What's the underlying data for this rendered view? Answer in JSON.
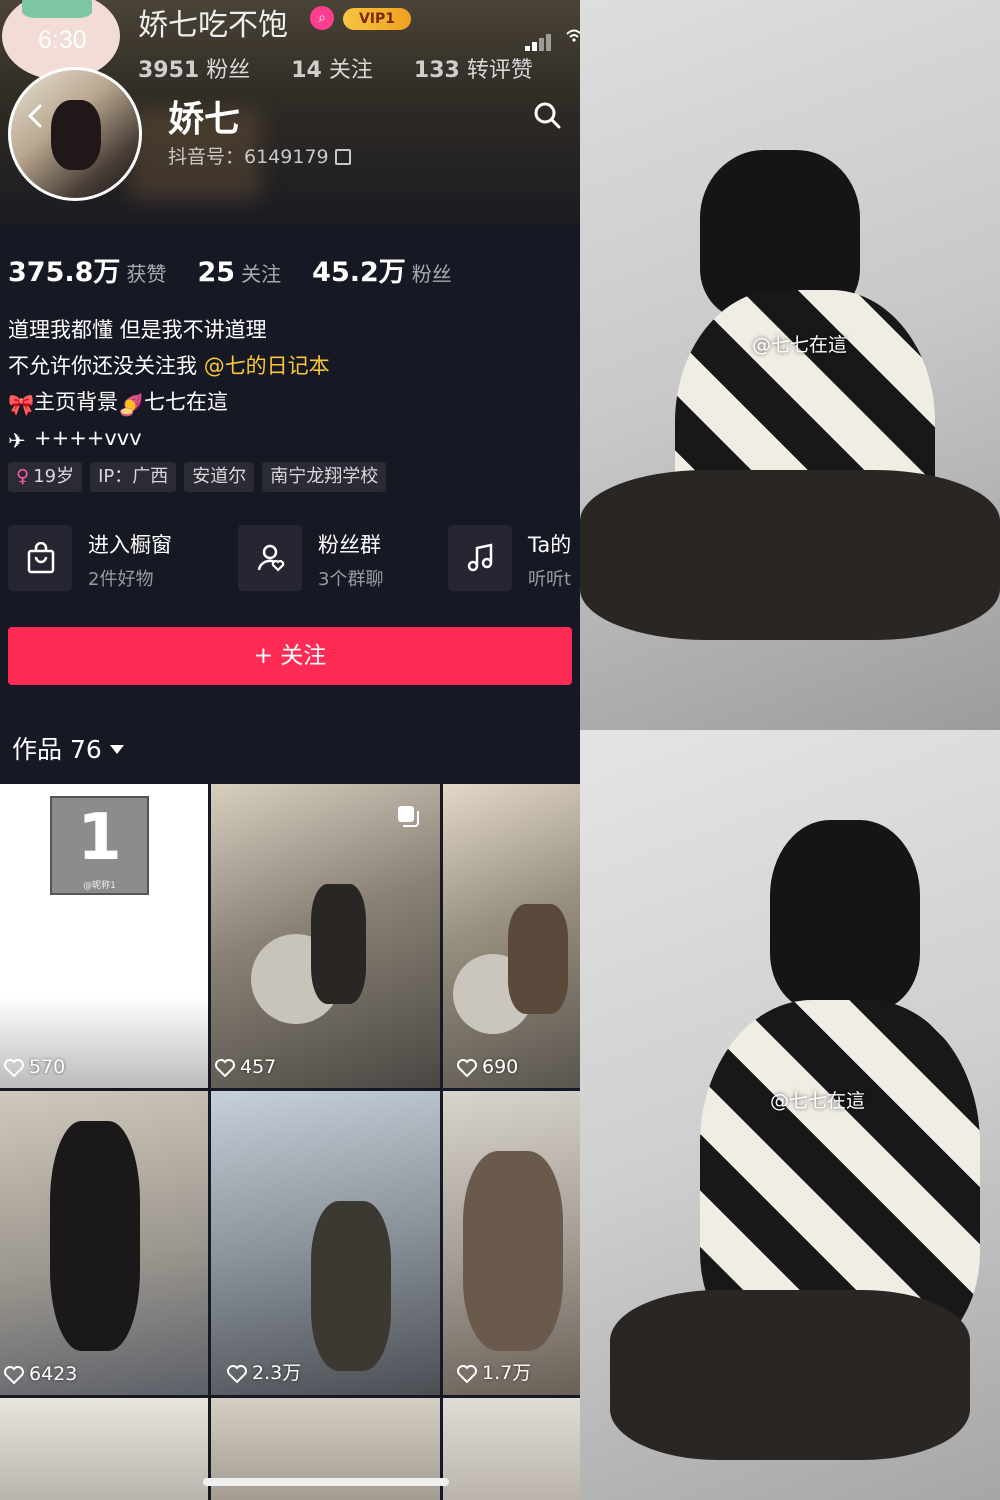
{
  "status_bar": {
    "time": "6:30"
  },
  "top_overlay": {
    "nickname": "娇七吃不饱",
    "vip_label": "VIP1",
    "stats": [
      {
        "num": "3951",
        "label": "粉丝"
      },
      {
        "num": "14",
        "label": "关注"
      },
      {
        "num": "133",
        "label": "转评赞"
      }
    ]
  },
  "profile": {
    "name": "娇七",
    "douyin_id": "抖音号：6149179"
  },
  "stats": [
    {
      "num": "375.8万",
      "label": "获赞"
    },
    {
      "num": "25",
      "label": "关注"
    },
    {
      "num": "45.2万",
      "label": "粉丝"
    }
  ],
  "bio": {
    "line1": "道理我都懂 但是我不讲道理",
    "line2_prefix": "不允许你还没关注我 ",
    "line2_mention": "@七的日记本",
    "line3": "主页背景",
    "line3_suffix": "七七在這",
    "line4": "++++vvv"
  },
  "tags": [
    "19岁",
    "IP：广西",
    "安道尔",
    "南宁龙翔学校"
  ],
  "actions": [
    {
      "title": "进入橱窗",
      "sub": "2件好物",
      "icon": "shopping-bag-icon"
    },
    {
      "title": "粉丝群",
      "sub": "3个群聊",
      "icon": "fan-group-icon"
    },
    {
      "title": "Ta的",
      "sub": "听听t",
      "icon": "music-note-icon"
    }
  ],
  "follow_button": "+ 关注",
  "works": {
    "label": "作品 76"
  },
  "grid": [
    {
      "likes": "570",
      "placeholder_num": "1",
      "placeholder_caption": "@昵称1"
    },
    {
      "likes": "457"
    },
    {
      "likes": "690"
    },
    {
      "likes": "6423"
    },
    {
      "likes": "2.3万"
    },
    {
      "likes": "1.7万"
    }
  ],
  "watermarks": [
    "@七七在這",
    "@七七在這"
  ],
  "colors": {
    "accent": "#fe2c55",
    "background": "#161823",
    "mention": "#f8c73a"
  }
}
